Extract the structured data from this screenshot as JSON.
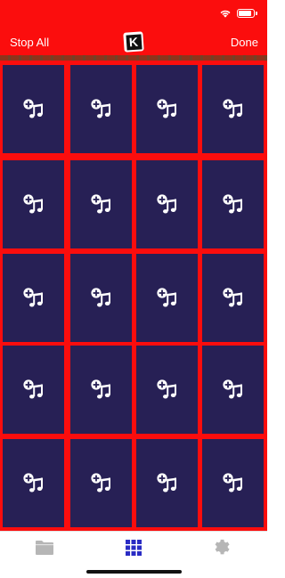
{
  "status_bar": {
    "wifi_icon": "wifi-icon",
    "battery_icon": "battery-icon"
  },
  "nav": {
    "left_label": "Stop All",
    "right_label": "Done",
    "logo_letter": "K",
    "logo_icon": "app-logo"
  },
  "grid": {
    "rows": 5,
    "columns": 4,
    "pad_icon": "add-music-icon"
  },
  "tab_bar": {
    "items": [
      {
        "icon": "folder-icon",
        "selected": false
      },
      {
        "icon": "grid-icon",
        "selected": true
      },
      {
        "icon": "gear-icon",
        "selected": false
      }
    ]
  },
  "colors": {
    "background_red": "#fb0d0d",
    "pad_navy": "#272055",
    "tab_selected": "#2a2cc4",
    "tab_unselected": "#b6b6b6"
  }
}
